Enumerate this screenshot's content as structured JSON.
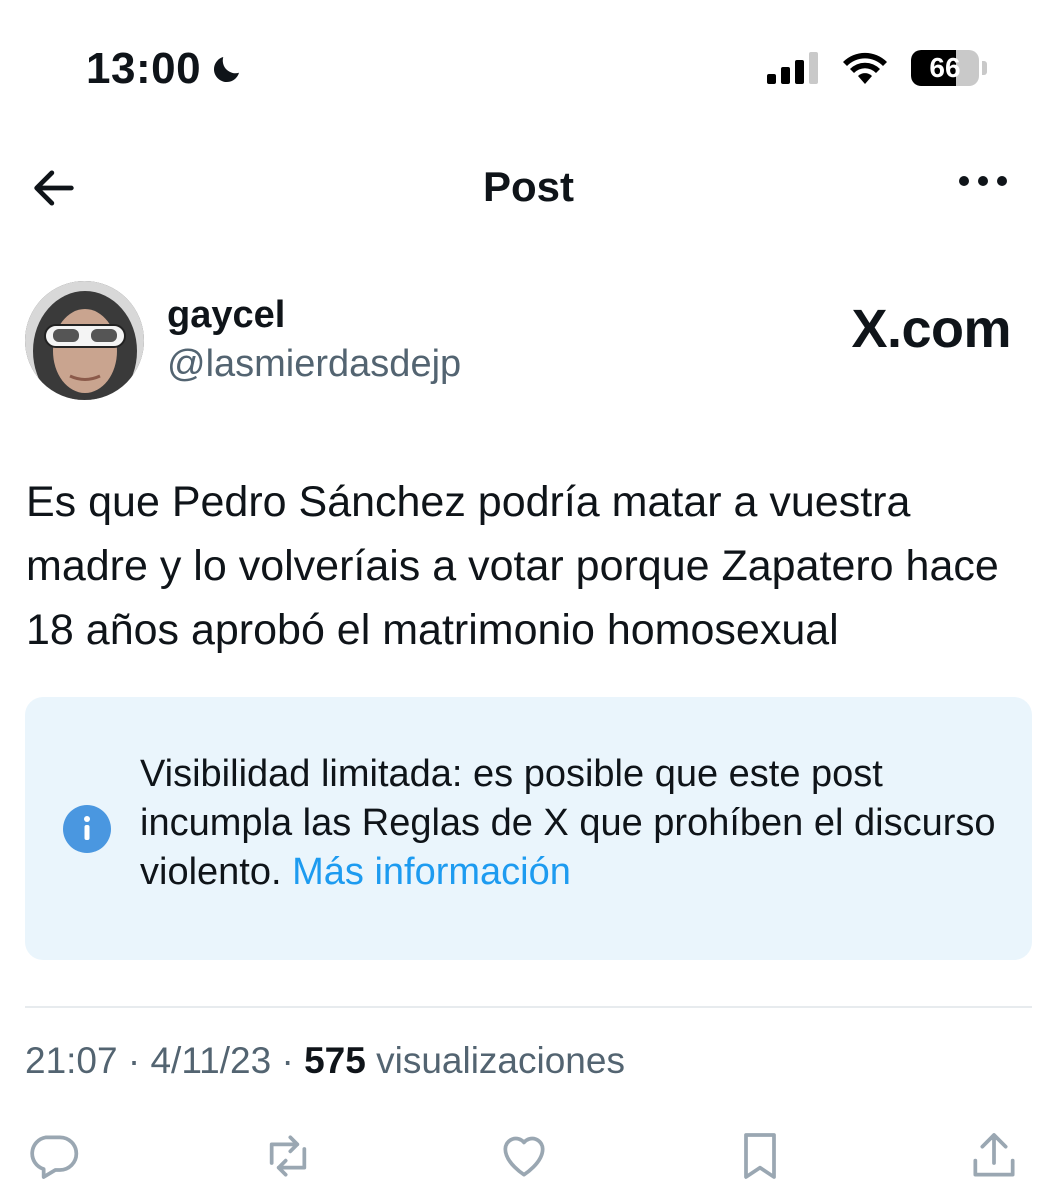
{
  "status_bar": {
    "time": "13:00",
    "battery": "66",
    "battery_level": 0.66
  },
  "nav": {
    "title": "Post"
  },
  "post": {
    "author_name": "gaycel",
    "author_handle": "@lasmierdasdejp",
    "watermark": "X.com",
    "text": "Es que Pedro Sánchez podría matar a vuestra madre y lo volveríais a votar porque Zapatero hace 18 años aprobó el matrimonio homosexual",
    "notice": {
      "text": "Visibilidad limitada: es posible que este post incumpla las Reglas de X que prohíben el discurso violento.",
      "link": "Más información"
    },
    "meta": {
      "time": "21:07",
      "sep1": " · ",
      "date": "4/11/23",
      "sep2": " · ",
      "views": "575",
      "views_label": " visualizaciones"
    }
  },
  "icons": {
    "back": "arrow-left-icon",
    "more": "more-horizontal-icon",
    "moon": "moon-icon",
    "signal": "cellular-signal-icon",
    "wifi": "wifi-icon",
    "info": "info-icon",
    "reply": "reply-icon",
    "repost": "repost-icon",
    "like": "heart-icon",
    "bookmark": "bookmark-icon",
    "share": "share-icon"
  },
  "colors": {
    "accent": "#1d9bf0",
    "notice_bg": "#eaf5fc",
    "muted": "#536471",
    "action_icon": "#9aa7b2"
  }
}
